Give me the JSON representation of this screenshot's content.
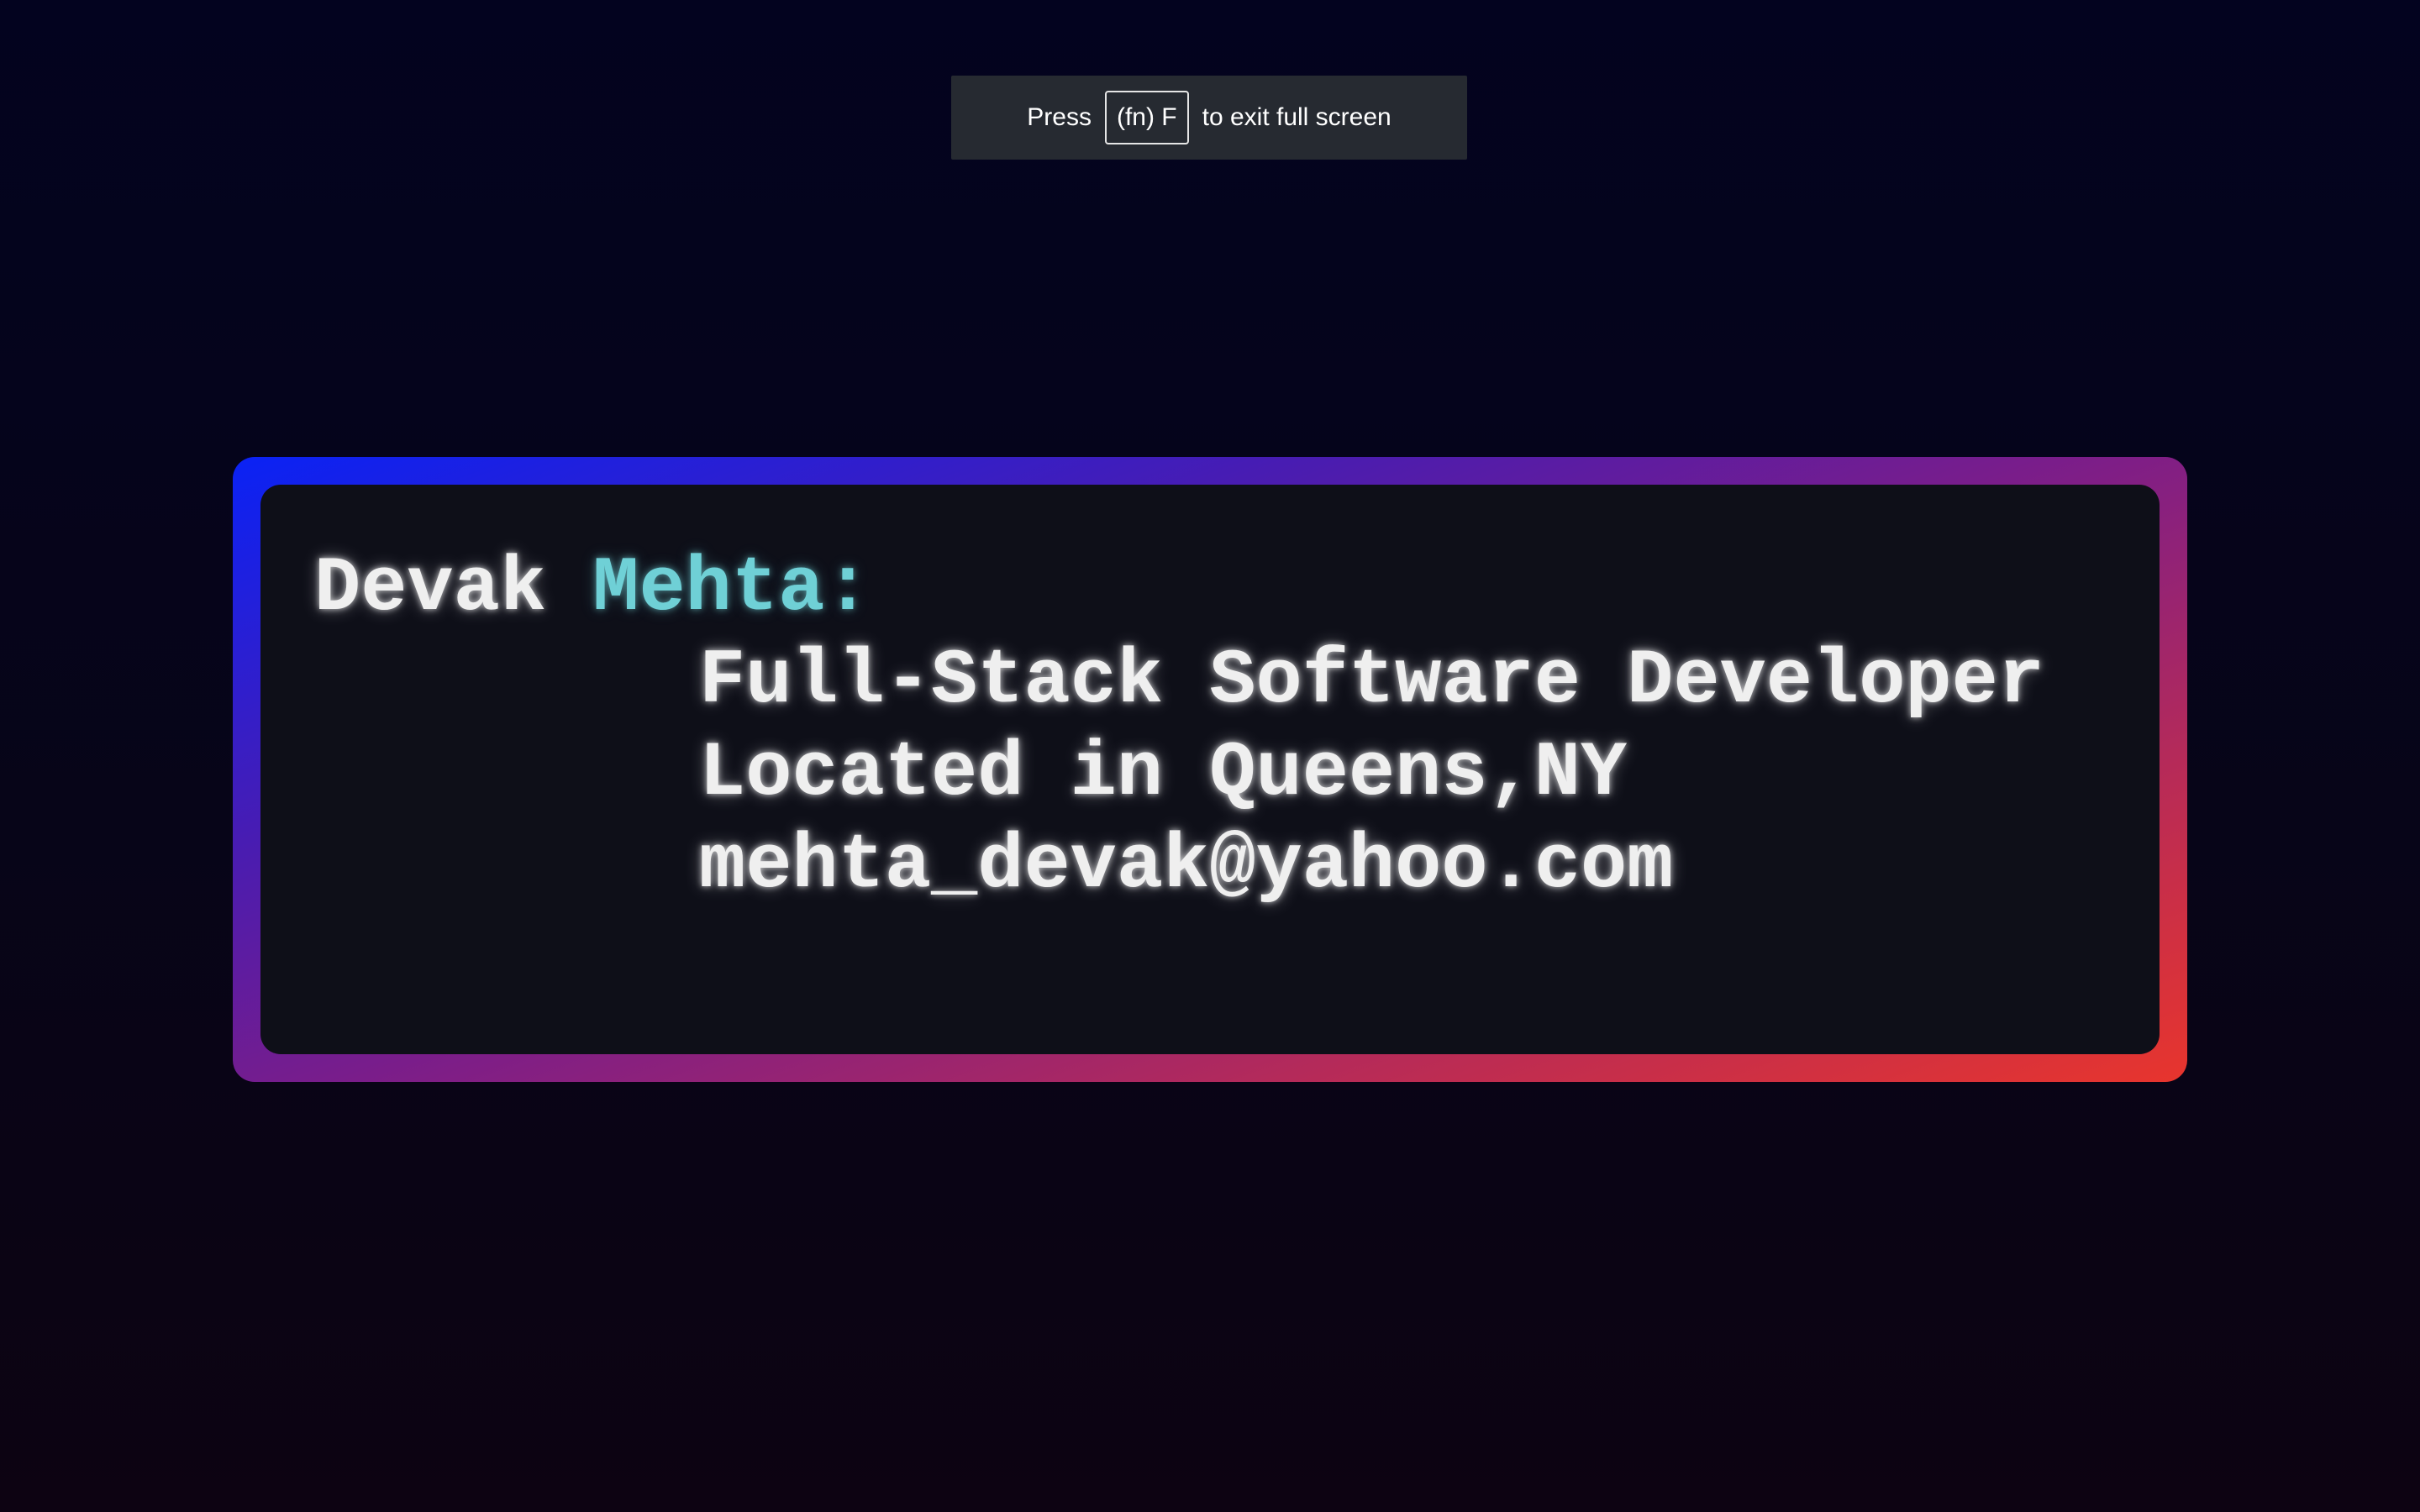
{
  "fullscreen_notice": {
    "prefix": "Press",
    "key": "(fn) F",
    "suffix": "to exit full screen"
  },
  "profile": {
    "first_name": "Devak",
    "last_name": "Mehta:",
    "lines": [
      "Full-Stack Software Developer",
      "Located in Queens,NY",
      "mehta_devak@yahoo.com"
    ]
  },
  "colors": {
    "accent": "#6fd0d6",
    "gradient_start": "#0a22f5",
    "gradient_end": "#e8352d",
    "card_bg": "#0e0f18"
  }
}
